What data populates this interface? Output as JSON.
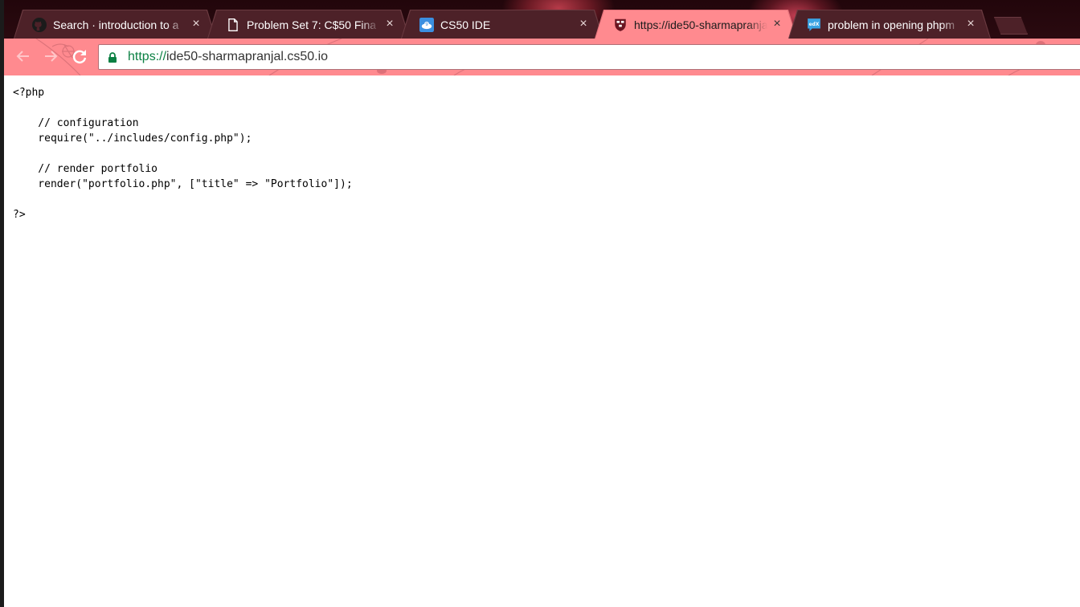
{
  "browser": {
    "tabs": [
      {
        "title": "Search · introduction to a",
        "icon": "github-icon",
        "active": false
      },
      {
        "title": "Problem Set 7: C$50 Fina",
        "icon": "document-icon",
        "active": false
      },
      {
        "title": "CS50 IDE",
        "icon": "cloud9-icon",
        "active": false
      },
      {
        "title": "https://ide50-sharmapranjal",
        "icon": "harvard-shield-icon",
        "active": true
      },
      {
        "title": "problem in opening phpm",
        "icon": "edx-icon",
        "active": false
      }
    ],
    "close_glyph": "×",
    "new_tab_icon": "new-tab-icon",
    "toolbar": {
      "back_icon": "back-arrow-icon",
      "forward_icon": "forward-arrow-icon",
      "reload_icon": "reload-icon",
      "secure_icon": "lock-icon",
      "url_scheme": "https://",
      "url_host": "ide50-sharmapranjal.cs50.io"
    },
    "colors": {
      "theme_pink": "#ff8a8f",
      "url_scheme_green": "#0b8043",
      "lock_green": "#0b8043"
    }
  },
  "page": {
    "code_lines": [
      "<?php",
      "",
      "    // configuration",
      "    require(\"../includes/config.php\");",
      "",
      "    // render portfolio",
      "    render(\"portfolio.php\", [\"title\" => \"Portfolio\"]);",
      "",
      "?>"
    ]
  }
}
